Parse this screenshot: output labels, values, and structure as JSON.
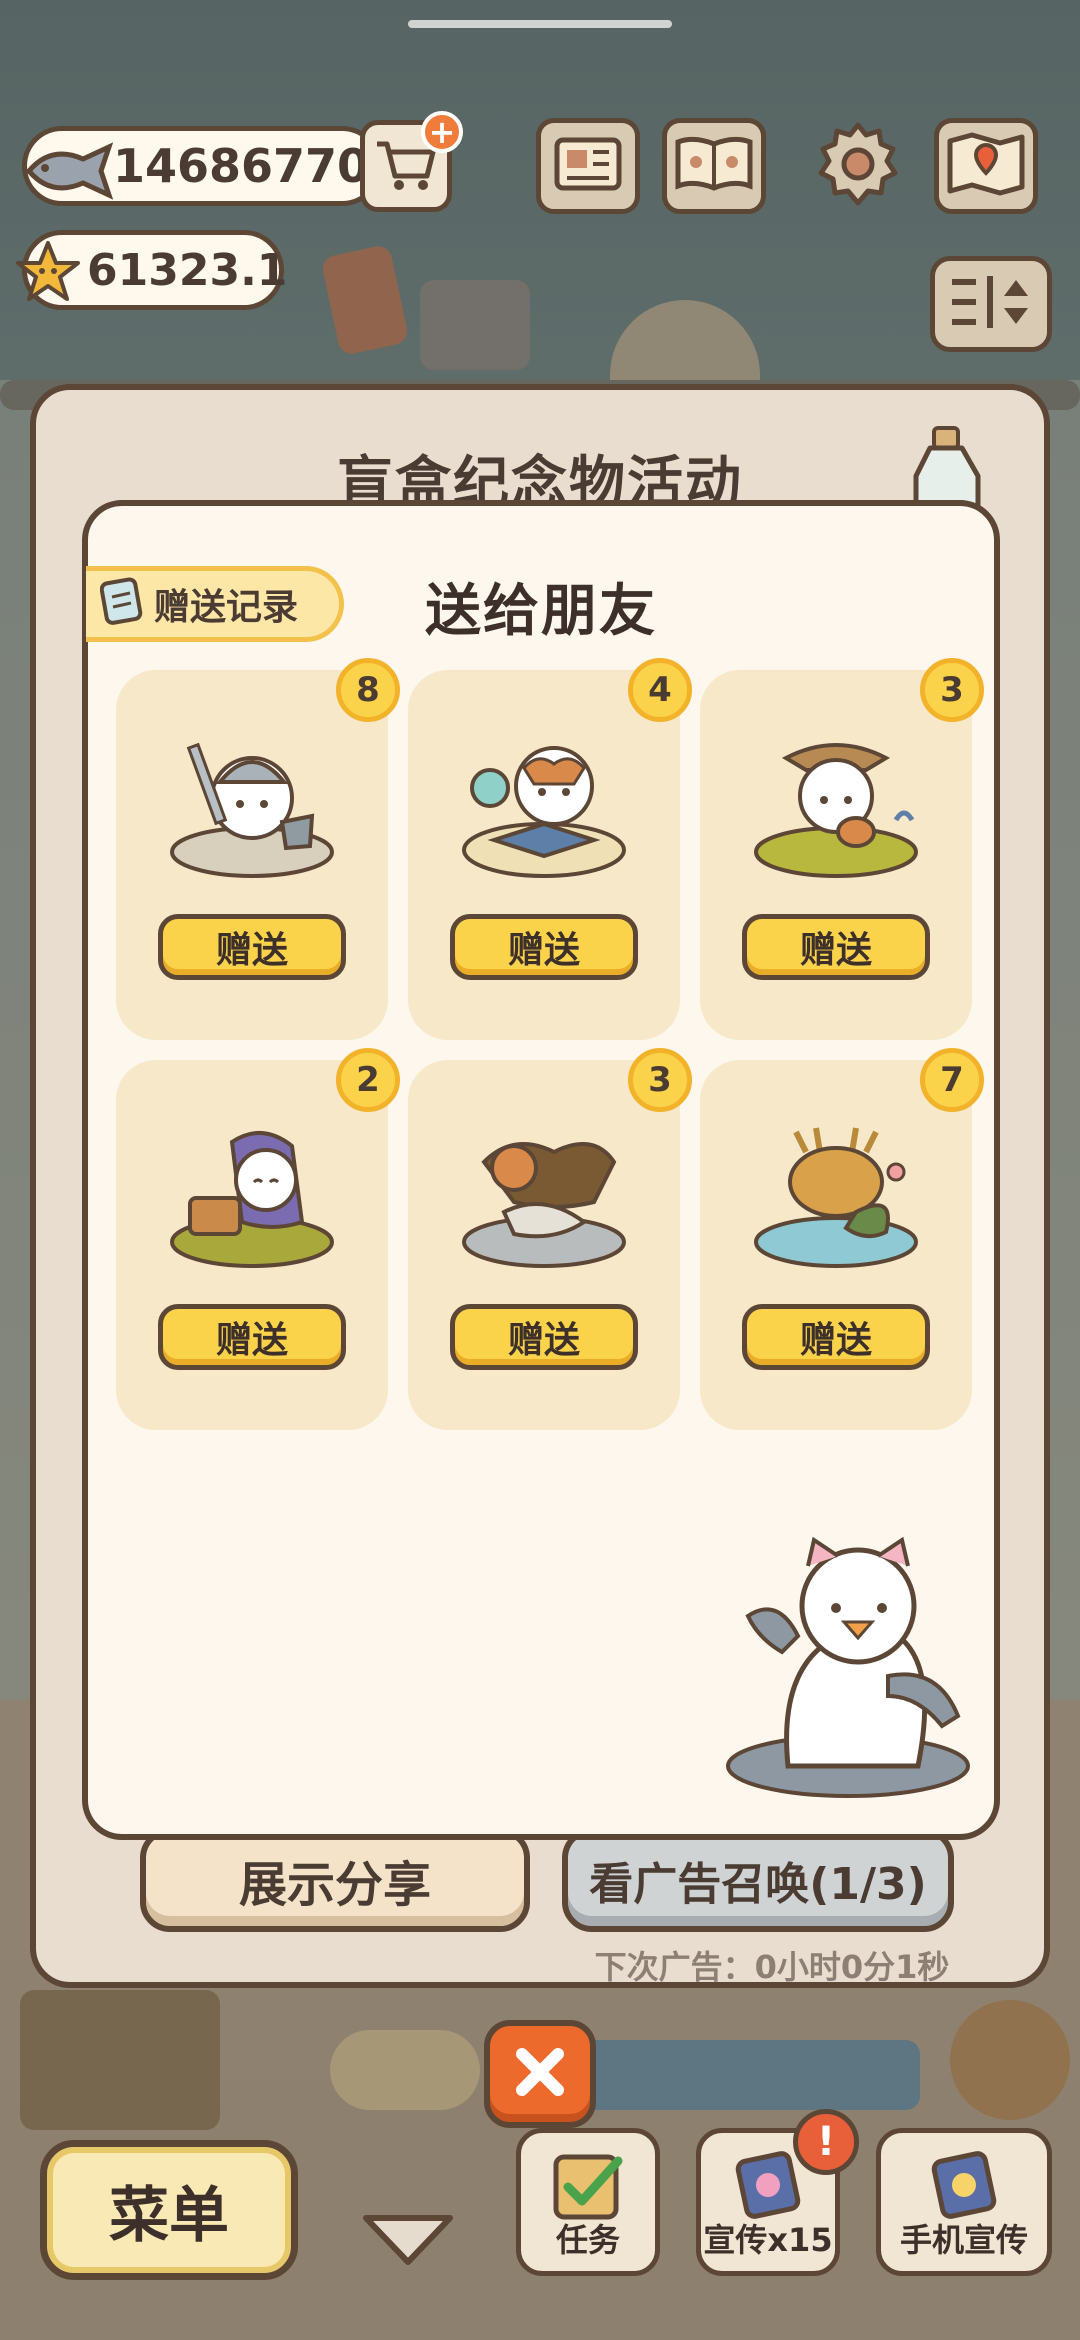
{
  "hud": {
    "fish_amount": "14686770",
    "star_amount": "61323.1"
  },
  "event_panel": {
    "title": "盲盒纪念物活动",
    "share_label": "展示分享",
    "ad_label": "看广告召唤(1/3)",
    "ad_timer": "下次广告：0小时0分1秒"
  },
  "gift_panel": {
    "title": "送给朋友",
    "record_label": "赠送记录",
    "items": [
      {
        "count": "8",
        "button_label": "赠送",
        "icon": "knight-cat-figurine"
      },
      {
        "count": "4",
        "button_label": "赠送",
        "icon": "alchemist-cat-figurine"
      },
      {
        "count": "3",
        "button_label": "赠送",
        "icon": "bard-cat-figurine"
      },
      {
        "count": "2",
        "button_label": "赠送",
        "icon": "treasure-cat-figurine"
      },
      {
        "count": "3",
        "button_label": "赠送",
        "icon": "dragon-rider-figurine"
      },
      {
        "count": "7",
        "button_label": "赠送",
        "icon": "deer-dragon-figurine"
      }
    ]
  },
  "bottom_bar": {
    "menu_label": "菜单",
    "task_label": "任务",
    "promote_label": "宣传x15",
    "promote_alert": "!",
    "phone_promote_label": "手机宣传"
  },
  "colors": {
    "accent_yellow": "#fbd34a",
    "outline_brown": "#5c4636",
    "close_orange": "#ec6a2c"
  }
}
